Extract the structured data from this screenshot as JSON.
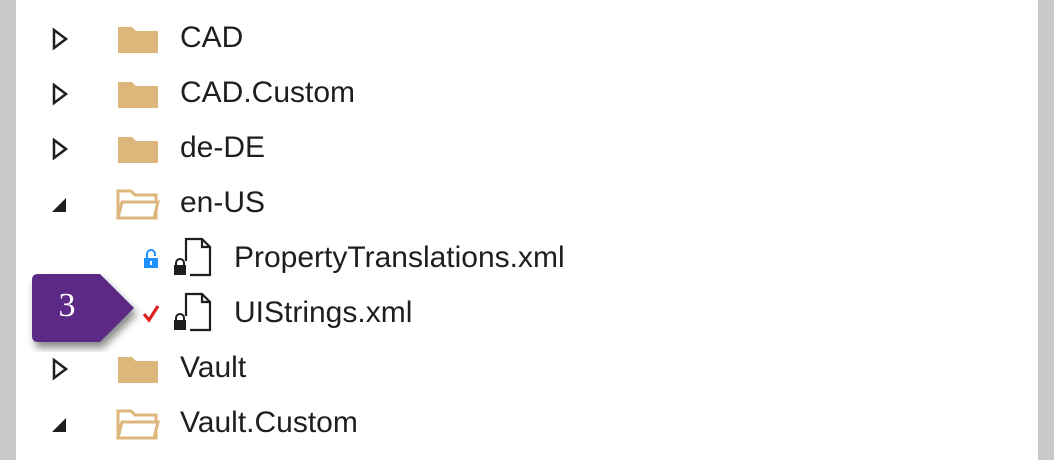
{
  "tree": {
    "items": [
      {
        "label": "CAD",
        "expanded": false,
        "type": "folder"
      },
      {
        "label": "CAD.Custom",
        "expanded": false,
        "type": "folder"
      },
      {
        "label": "de-DE",
        "expanded": false,
        "type": "folder"
      },
      {
        "label": "en-US",
        "expanded": true,
        "type": "folder"
      },
      {
        "label": "PropertyTranslations.xml",
        "type": "file",
        "status": "locked-icon"
      },
      {
        "label": "UIStrings.xml",
        "type": "file",
        "status": "checked-out-icon"
      },
      {
        "label": "Vault",
        "expanded": false,
        "type": "folder"
      },
      {
        "label": "Vault.Custom",
        "expanded": true,
        "type": "folder"
      }
    ]
  },
  "callout": {
    "number": "3",
    "color": "#5b2a86"
  },
  "colors": {
    "folder": "#dcb67a",
    "status_red": "#e02020",
    "status_blue": "#1e90ff"
  }
}
